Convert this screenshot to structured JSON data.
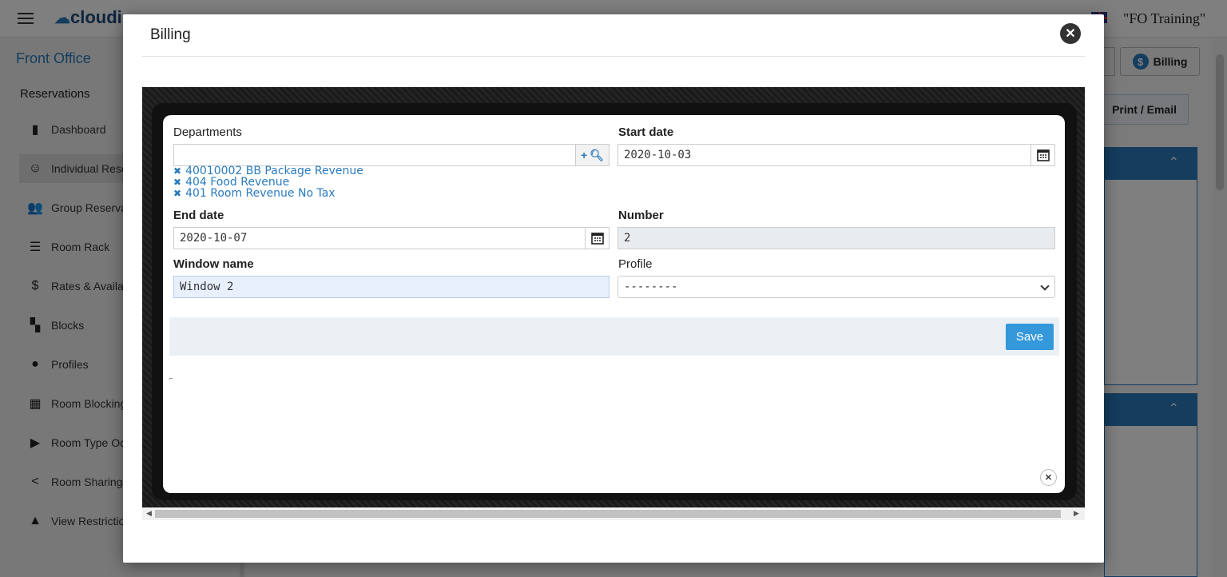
{
  "app": {
    "logo": "cloudi",
    "property": "\"FO Training\"",
    "section_title": "Front Office",
    "reservations_header": "Reservations",
    "nav": [
      {
        "label": "Dashboard",
        "icon": "bar-chart-icon"
      },
      {
        "label": "Individual Rese",
        "icon": "person-icon",
        "active": true
      },
      {
        "label": "Group Reserva",
        "icon": "group-icon"
      },
      {
        "label": "Room Rack",
        "icon": "list-icon"
      },
      {
        "label": "Rates & Availa",
        "icon": "dollar-icon"
      },
      {
        "label": "Blocks",
        "icon": "blocks-icon"
      },
      {
        "label": "Profiles",
        "icon": "profile-icon"
      },
      {
        "label": "Room Blocking",
        "icon": "grid-icon"
      },
      {
        "label": "Room Type Oc",
        "icon": "tag-icon"
      },
      {
        "label": "Room Sharing",
        "icon": "share-icon"
      },
      {
        "label": "View Restrictio",
        "icon": "warning-icon"
      }
    ],
    "billing_button": "Billing",
    "print_button": "Print / Email"
  },
  "modal": {
    "title": "Billing",
    "form": {
      "departments_label": "Departments",
      "departments_value": "",
      "departments": [
        "40010002 BB Package Revenue",
        "404 Food Revenue",
        "401 Room Revenue No Tax"
      ],
      "start_date_label": "Start date",
      "start_date_value": "2020-10-03",
      "end_date_label": "End date",
      "end_date_value": "2020-10-07",
      "number_label": "Number",
      "number_value": "2",
      "window_name_label": "Window name",
      "window_name_value": "Window 2",
      "profile_label": "Profile",
      "profile_value": "--------",
      "save_label": "Save"
    }
  },
  "colors": {
    "accent": "#2a7bbd",
    "save": "#3498db"
  }
}
